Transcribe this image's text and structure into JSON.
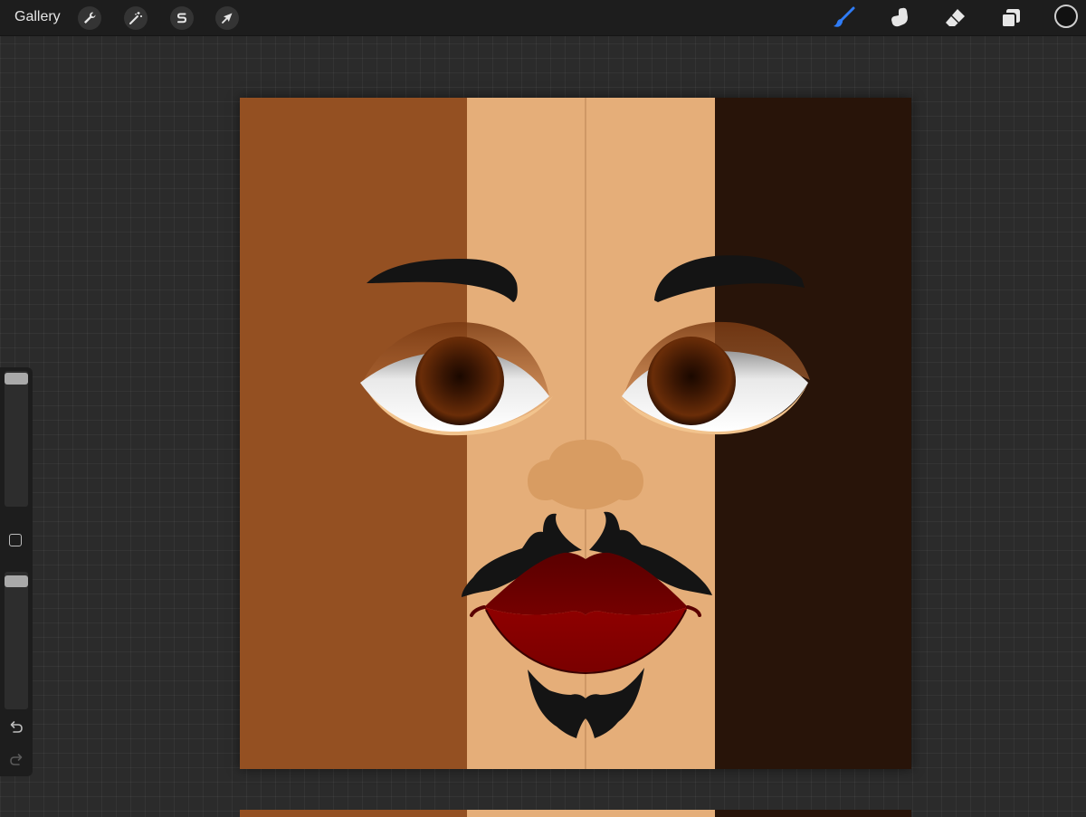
{
  "topbar": {
    "gallery_label": "Gallery",
    "left_tools": [
      {
        "name": "actions",
        "icon": "wrench-icon"
      },
      {
        "name": "adjustments",
        "icon": "magic-wand-icon"
      },
      {
        "name": "selection",
        "icon": "selection-s-icon"
      },
      {
        "name": "transform",
        "icon": "arrow-cursor-icon"
      }
    ],
    "right_tools": [
      {
        "name": "brush",
        "icon": "brush-icon",
        "active": true
      },
      {
        "name": "smudge",
        "icon": "smudge-finger-icon",
        "active": false
      },
      {
        "name": "eraser",
        "icon": "eraser-icon",
        "active": false
      },
      {
        "name": "layers",
        "icon": "layers-icon",
        "active": false
      }
    ],
    "current_color": "#111111",
    "accent_color": "#2f7cf6"
  },
  "sidebar": {
    "brush_size_level": 0.0,
    "brush_opacity_level": 0.0,
    "icons": [
      "modify-square-icon",
      "undo-icon",
      "redo-icon"
    ]
  },
  "canvas": {
    "skin_tones": [
      "#945022",
      "#e5ae79",
      "#281409"
    ],
    "lip_colors": [
      "#6c0000",
      "#8c0000"
    ],
    "hair_color": "#141414",
    "iris_color": "#4a1d05",
    "eyeshadow_color": "#9b5b2f"
  }
}
